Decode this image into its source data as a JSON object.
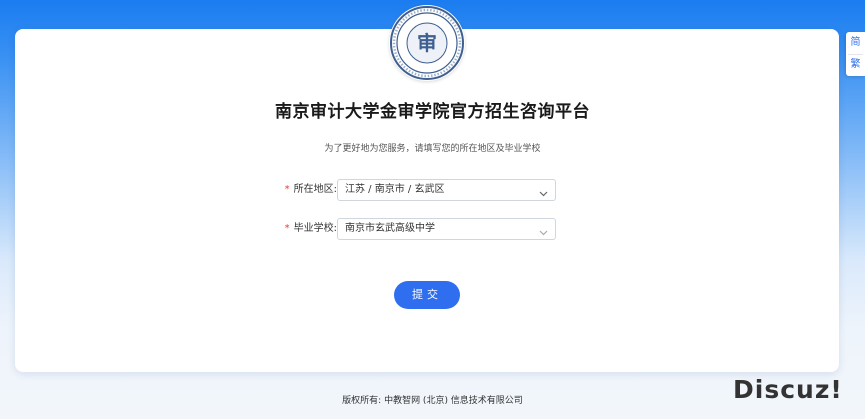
{
  "page": {
    "title": "南京审计大学金审学院官方招生咨询平台",
    "subtitle": "为了更好地为您服务，请填写您的所在地区及毕业学校"
  },
  "logo": {
    "icon": "university-seal-icon",
    "center_glyph": "审"
  },
  "form": {
    "region": {
      "required_mark": "*",
      "label": "所在地区:",
      "value": "江苏 / 南京市 / 玄武区",
      "icon": "chevron-down-icon"
    },
    "school": {
      "required_mark": "*",
      "label": "毕业学校:",
      "value": "南京市玄武高级中学",
      "icon": "chevron-down-icon"
    },
    "submit_label": "提交"
  },
  "language_switch": {
    "simplified": "简",
    "traditional": "繁"
  },
  "footer": {
    "copyright": "版权所有: 中教智网 (北京) 信息技术有限公司"
  },
  "watermark": {
    "text": "Discuz!"
  },
  "colors": {
    "primary": "#2f6fef",
    "required": "#e83e2f",
    "background_top": "#1a7cf0",
    "seal": "#3e5f8f"
  }
}
